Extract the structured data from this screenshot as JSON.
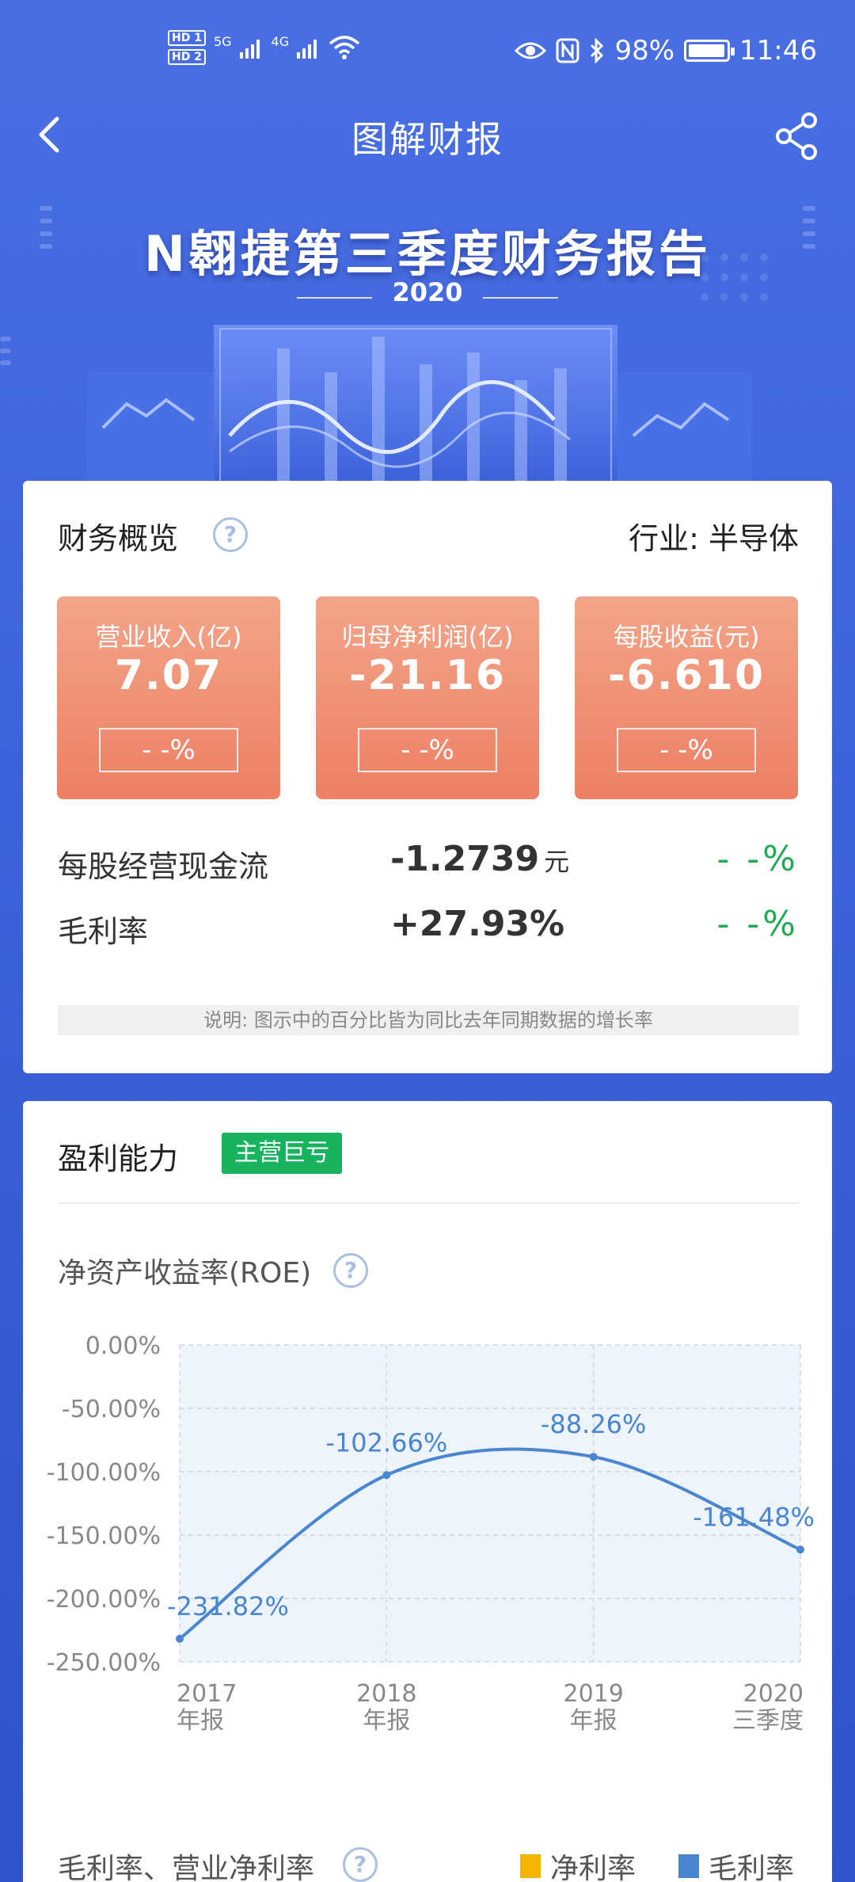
{
  "status_bar": {
    "hd1": "HD 1",
    "hd2": "HD 2",
    "net1": "5G",
    "net2": "4G",
    "battery_pct": "98%",
    "battery_level": 0.98,
    "time": "11:46"
  },
  "nav": {
    "title": "图解财报"
  },
  "banner": {
    "title": "N翱捷第三季度财务报告",
    "year": "2020"
  },
  "overview": {
    "title": "财务概览",
    "help": "?",
    "industry": "行业: 半导体",
    "tiles": [
      {
        "label": "营业收入(亿)",
        "value": "7.07",
        "change": "- -%"
      },
      {
        "label": "归母净利润(亿)",
        "value": "-21.16",
        "change": "- -%"
      },
      {
        "label": "每股收益(元)",
        "value": "-6.610",
        "change": "- -%"
      }
    ],
    "rows": [
      {
        "label": "每股经营现金流",
        "value": "-1.2739",
        "unit": "元",
        "change": "- -%"
      },
      {
        "label": "毛利率",
        "value": "+27.93%",
        "unit": "",
        "change": "- -%"
      }
    ],
    "note": "说明: 图示中的百分比皆为同比去年同期数据的增长率"
  },
  "profit": {
    "title": "盈利能力",
    "tag": "主营巨亏",
    "roe_title": "净资产收益率(ROE)",
    "help": "?",
    "bottom_title": "毛利率、营业净利率",
    "legend": [
      {
        "name": "净利率",
        "color": "#f5b400"
      },
      {
        "name": "毛利率",
        "color": "#4a86d0"
      }
    ]
  },
  "chart_data": {
    "type": "line",
    "categories": [
      "2017年报",
      "2018年报",
      "2019年报",
      "2020三季度"
    ],
    "x_labels_top": [
      "2017",
      "2018",
      "2019",
      "2020"
    ],
    "x_labels_bottom": [
      "年报",
      "年报",
      "年报",
      "三季度"
    ],
    "series": [
      {
        "values": [
          -231.82,
          -102.66,
          -88.26,
          -161.48
        ],
        "labels": [
          "-231.82%",
          "-102.66%",
          "-88.26%",
          "-161.48%"
        ],
        "color": "#4a86d0"
      }
    ],
    "y_ticks": [
      "0.00%",
      "-50.00%",
      "-100.00%",
      "-150.00%",
      "-200.00%",
      "-250.00%"
    ],
    "ylim": [
      -250,
      0
    ],
    "grid": true
  },
  "colors": {
    "accent": "#4a6fe3",
    "tile": "#ee7f64",
    "positive_green": "#1faa55",
    "tag_green": "#17b35e",
    "line": "#4a86d0"
  }
}
